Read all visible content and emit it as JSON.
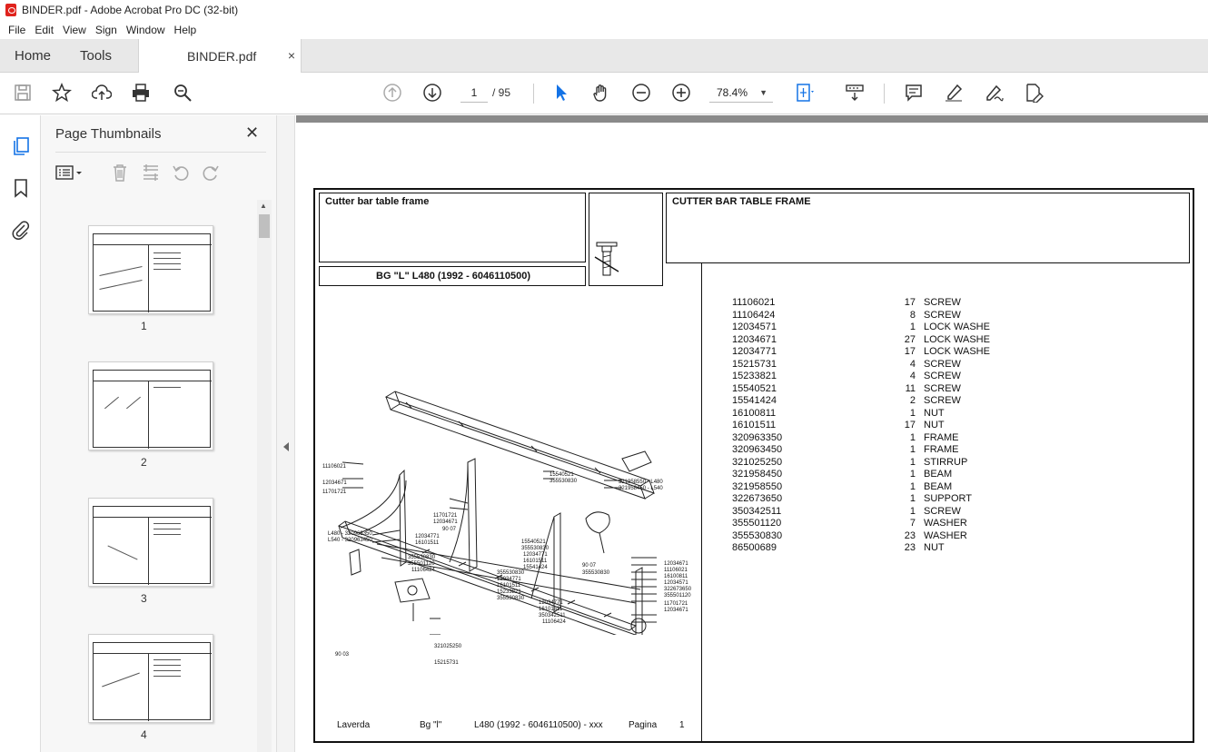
{
  "window": {
    "title": "BINDER.pdf - Adobe Acrobat Pro DC (32-bit)"
  },
  "menu": [
    "File",
    "Edit",
    "View",
    "Sign",
    "Window",
    "Help"
  ],
  "tabs": {
    "home": "Home",
    "tools": "Tools",
    "document": "BINDER.pdf",
    "close": "×"
  },
  "toolbar": {
    "page_current": "1",
    "page_total": "/ 95",
    "zoom": "78.4%"
  },
  "panel": {
    "title": "Page Thumbnails",
    "close": "✕",
    "thumbnails": [
      {
        "label": "1"
      },
      {
        "label": "2"
      },
      {
        "label": "3"
      },
      {
        "label": "4"
      }
    ]
  },
  "document": {
    "header_left": "Cutter bar table frame",
    "header_right": "CUTTER BAR TABLE FRAME",
    "model_line": "BG \"L\"  L480  (1992 - 6046110500)",
    "parts": [
      {
        "number": "11106021",
        "qty": "17",
        "desc": "SCREW"
      },
      {
        "number": "11106424",
        "qty": "8",
        "desc": "SCREW"
      },
      {
        "number": "12034571",
        "qty": "1",
        "desc": "LOCK WASHE"
      },
      {
        "number": "12034671",
        "qty": "27",
        "desc": "LOCK WASHE"
      },
      {
        "number": "12034771",
        "qty": "17",
        "desc": "LOCK WASHE"
      },
      {
        "number": "15215731",
        "qty": "4",
        "desc": "SCREW"
      },
      {
        "number": "15233821",
        "qty": "4",
        "desc": "SCREW"
      },
      {
        "number": "15540521",
        "qty": "11",
        "desc": "SCREW"
      },
      {
        "number": "15541424",
        "qty": "2",
        "desc": "SCREW"
      },
      {
        "number": "16100811",
        "qty": "1",
        "desc": "NUT"
      },
      {
        "number": "16101511",
        "qty": "17",
        "desc": "NUT"
      },
      {
        "number": "320963350",
        "qty": "1",
        "desc": "FRAME"
      },
      {
        "number": "320963450",
        "qty": "1",
        "desc": "FRAME"
      },
      {
        "number": "321025250",
        "qty": "1",
        "desc": "STIRRUP"
      },
      {
        "number": "321958450",
        "qty": "1",
        "desc": "BEAM"
      },
      {
        "number": "321958550",
        "qty": "1",
        "desc": "BEAM"
      },
      {
        "number": "322673650",
        "qty": "1",
        "desc": "SUPPORT"
      },
      {
        "number": "350342511",
        "qty": "1",
        "desc": "SCREW"
      },
      {
        "number": "355501120",
        "qty": "7",
        "desc": "WASHER"
      },
      {
        "number": "355530830",
        "qty": "23",
        "desc": "WASHER"
      },
      {
        "number": "86500689",
        "qty": "23",
        "desc": "NUT"
      }
    ],
    "footer": {
      "brand": "Laverda",
      "model": "Bg \"l\"",
      "serial": "L480  (1992 - 6046110500) - xxx",
      "page_label": "Pagina",
      "page_number": "1"
    },
    "callouts": {
      "c1": "11106021",
      "c2": "12034671",
      "c3": "11701721",
      "c4": "15540521",
      "c5": "355530830",
      "c6": "321958550 - L480",
      "c7": "321958450 - L540",
      "c8": "L480 - 320963350",
      "c9": "L540 - 320963450",
      "c10": "11701721",
      "c11": "12034671",
      "c12": "90 07",
      "c13": "12034771",
      "c14": "16101511",
      "c15": "355530830",
      "c16": "355501120",
      "c17": "11106424",
      "c18": "15540521",
      "c19": "355530830",
      "c20": "12034771",
      "c21": "16101511",
      "c22": "15541424",
      "c23": "90 07",
      "c24": "355530830",
      "c25": "12034671",
      "c26": "11106021",
      "c27": "16100811",
      "c28": "12034571",
      "c29": "322673650",
      "c30": "355501120",
      "c31": "11701721",
      "c32": "12034671",
      "c33": "355530830",
      "c34": "12034771",
      "c35": "16101511",
      "c36": "15233821",
      "c37": "355530830",
      "c38": "12034771",
      "c39": "16101511",
      "c40": "350342511",
      "c41": "11106424",
      "c42": "90 03",
      "c43": "321025250",
      "c44": "15215731"
    }
  },
  "colors": {
    "acrobat_red": "#e0231d",
    "accent_blue": "#1473e6"
  }
}
